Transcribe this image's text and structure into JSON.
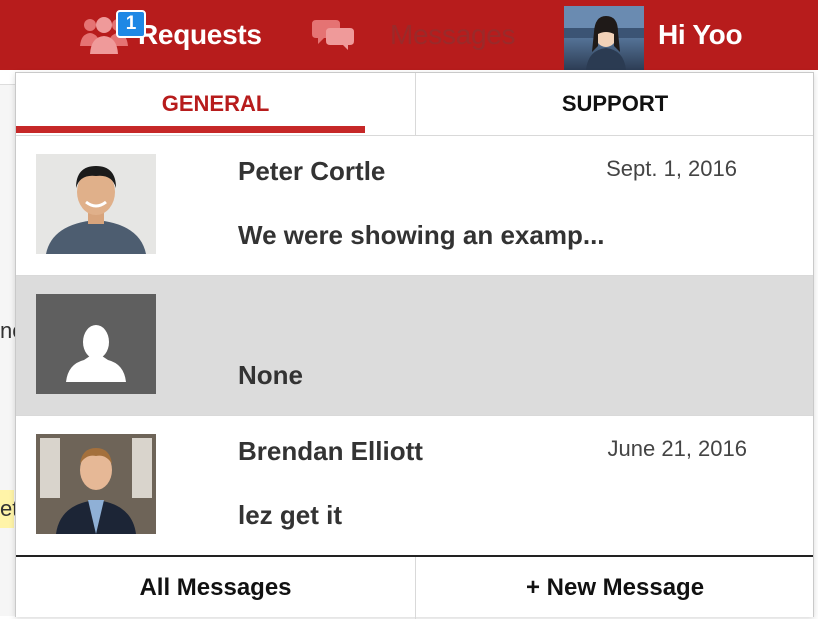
{
  "nav": {
    "requests_label": "Requests",
    "requests_badge": "1",
    "messages_label": "Messages",
    "greeting": "Hi Yoo",
    "colors": {
      "bar": "#b71c1c",
      "badge": "#1e88e5",
      "icon_faded": "#e57373"
    }
  },
  "background": {
    "fragment_1": "nc",
    "fragment_2": "et"
  },
  "tabs": [
    {
      "label": "GENERAL",
      "active": true
    },
    {
      "label": "SUPPORT",
      "active": false
    }
  ],
  "messages": [
    {
      "name": "Peter Cortle",
      "date": "Sept. 1, 2016",
      "preview": "We were showing an examp...",
      "avatar": "photo-man-smiling"
    },
    {
      "name": "",
      "date": "",
      "preview": "None",
      "avatar": "default-user-icon"
    },
    {
      "name": "Brendan Elliott",
      "date": "June 21, 2016",
      "preview": "lez get it",
      "avatar": "photo-man-suit"
    }
  ],
  "footer": {
    "all_messages_label": "All Messages",
    "new_message_label": "+ New Message"
  }
}
